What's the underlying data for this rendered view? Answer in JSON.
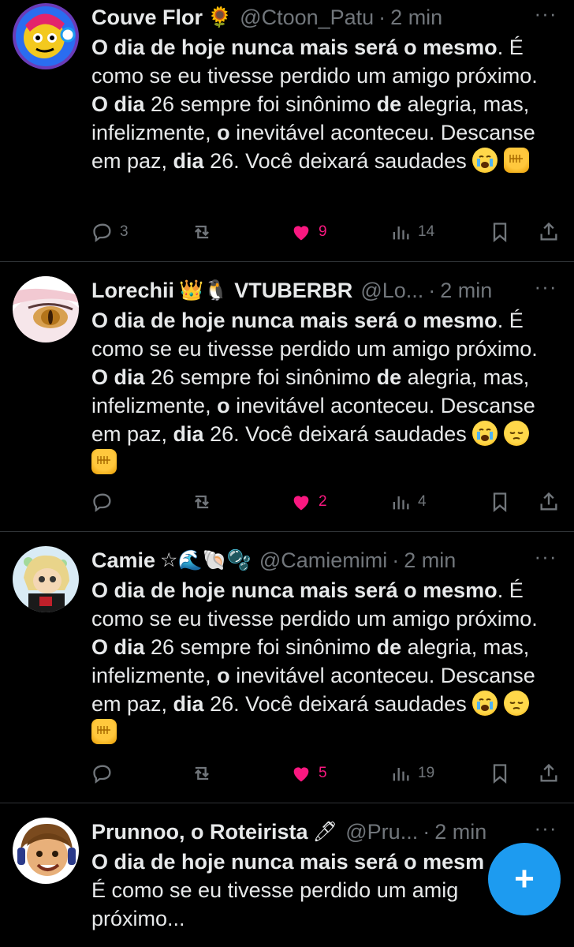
{
  "colors": {
    "background": "#000000",
    "text": "#e7e9ea",
    "muted": "#71767b",
    "like": "#f91880",
    "accent": "#1d9bf0"
  },
  "tweets": [
    {
      "name": "Couve Flor",
      "name_emoji": "🌻",
      "handle": "@Ctoon_Patu",
      "dot": "·",
      "time": "2 min",
      "more": "···",
      "text_parts": [
        {
          "b": "O dia de hoje nunca mais será o mesmo"
        },
        {
          "t": ". É como se eu tivesse perdido um amigo próximo. "
        },
        {
          "b": "O dia"
        },
        {
          "t": " 26 sempre foi sinônimo "
        },
        {
          "b": "de"
        },
        {
          "t": " alegria, mas, infelizmente, "
        },
        {
          "b": "o"
        },
        {
          "t": " inevitável aconteceu. Descanse em paz, "
        },
        {
          "b": "dia"
        },
        {
          "t": " 26. Você deixará saudades "
        }
      ],
      "emojis": [
        "crying-face",
        "raised-fist"
      ],
      "replies": "3",
      "retweets": "",
      "likes": "9",
      "views": "14"
    },
    {
      "name": "Lorechii",
      "name_emoji": "👑🐧",
      "name_suffix": "VTUBERBR",
      "handle": "@Lo...",
      "dot": "·",
      "time": "2 min",
      "more": "···",
      "text_parts": [
        {
          "b": "O dia de hoje nunca mais será o mesmo"
        },
        {
          "t": ". É como se eu tivesse perdido um amigo próximo. "
        },
        {
          "b": "O dia"
        },
        {
          "t": " 26 sempre foi sinônimo "
        },
        {
          "b": "de"
        },
        {
          "t": " alegria, mas, infelizmente, "
        },
        {
          "b": "o"
        },
        {
          "t": " inevitável aconteceu. Descanse em paz, "
        },
        {
          "b": "dia"
        },
        {
          "t": " 26. Você deixará saudades "
        }
      ],
      "emojis": [
        "crying-face",
        "pensive-face",
        "raised-fist"
      ],
      "replies": "",
      "retweets": "",
      "likes": "2",
      "views": "4"
    },
    {
      "name": "Camie",
      "name_emoji": "☆🌊🐚🫧",
      "handle": "@Camiemimi",
      "dot": "·",
      "time": "2 min",
      "more": "···",
      "text_parts": [
        {
          "b": "O dia de hoje nunca mais será o mesmo"
        },
        {
          "t": ". É como se eu tivesse perdido um amigo próximo. "
        },
        {
          "b": "O dia"
        },
        {
          "t": " 26 sempre foi sinônimo "
        },
        {
          "b": "de"
        },
        {
          "t": " alegria, mas, infelizmente, "
        },
        {
          "b": "o"
        },
        {
          "t": " inevitável aconteceu. Descanse em paz, "
        },
        {
          "b": "dia"
        },
        {
          "t": " 26. Você deixará saudades "
        }
      ],
      "emojis": [
        "crying-face",
        "pensive-face",
        "raised-fist"
      ],
      "replies": "",
      "retweets": "",
      "likes": "5",
      "views": "19"
    },
    {
      "name": "Prunnoo, o Roteirista",
      "name_emoji": "🖊",
      "handle": "@Pru...",
      "dot": "·",
      "time": "2 min",
      "more": "···",
      "text_line1": "O dia de hoje nunca mais será o mesm",
      "text_line2": "É como se eu tivesse perdido um amig",
      "text_line3": "próximo..."
    }
  ],
  "fab": {
    "label": "+",
    "icon": "compose-plus-icon"
  }
}
